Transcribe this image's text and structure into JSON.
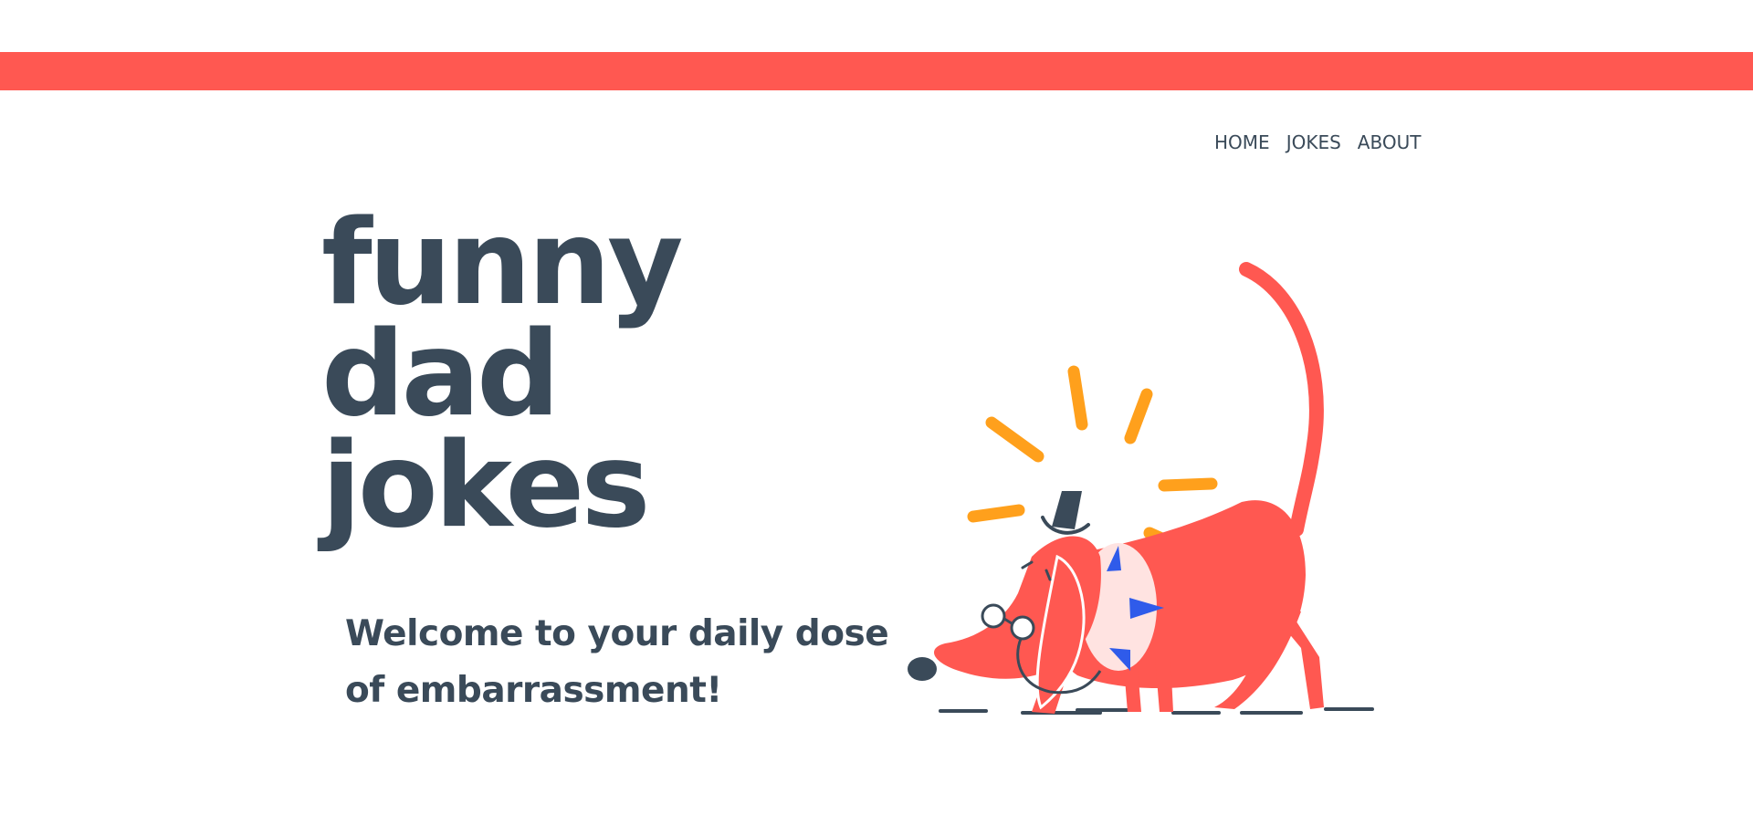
{
  "nav": {
    "items": [
      {
        "label": "HOME"
      },
      {
        "label": "JOKES"
      },
      {
        "label": "ABOUT"
      }
    ]
  },
  "hero": {
    "title_lines": [
      "funny",
      "dad",
      "jokes"
    ],
    "subtitle": "Welcome to your daily dose of embarrassment!"
  },
  "colors": {
    "accent": "#ff5851",
    "text": "#3a4a59",
    "sparkle": "#ffa01c",
    "collar_spikes": "#2f5bea",
    "chest": "#ffe3e1"
  },
  "illustration": {
    "icon": "dachshund-with-top-hat-illustration"
  }
}
